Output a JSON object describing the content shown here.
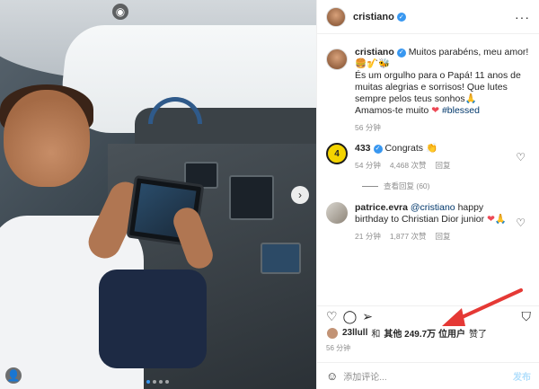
{
  "post": {
    "username": "cristiano",
    "caption": {
      "username": "cristiano",
      "text_line1": "Muitos parabéns, meu amor!",
      "text_line2": "És um orgulho para o Papá! 11 anos de muitas alegrias e sorrisos! Que lutes sempre pelos teus sonhos",
      "text_line3": "Amamos-te muito",
      "hashtag": "#blessed",
      "time": "56 分钟"
    },
    "comments": [
      {
        "username": "433",
        "text": "Congrats",
        "time": "54 分钟",
        "likes": "4,468 次赞",
        "reply": "回复"
      },
      {
        "username": "patrice.evra",
        "mention": "@cristiano",
        "text": "happy birthday to Christian Dior junior",
        "time": "21 分钟",
        "likes": "1,877 次赞",
        "reply": "回复"
      }
    ],
    "view_replies": "查看回复 (60)",
    "likes_line": {
      "user": "23llull",
      "and": "和",
      "others": "其他 249.7万 位用户",
      "liked": "赞了"
    },
    "post_time": "56 分钟",
    "add_comment_placeholder": "添加评论...",
    "post_button": "发布",
    "colors": {
      "accent": "#3897f0",
      "heart": "#ed4956",
      "arrow": "#e53935"
    }
  }
}
